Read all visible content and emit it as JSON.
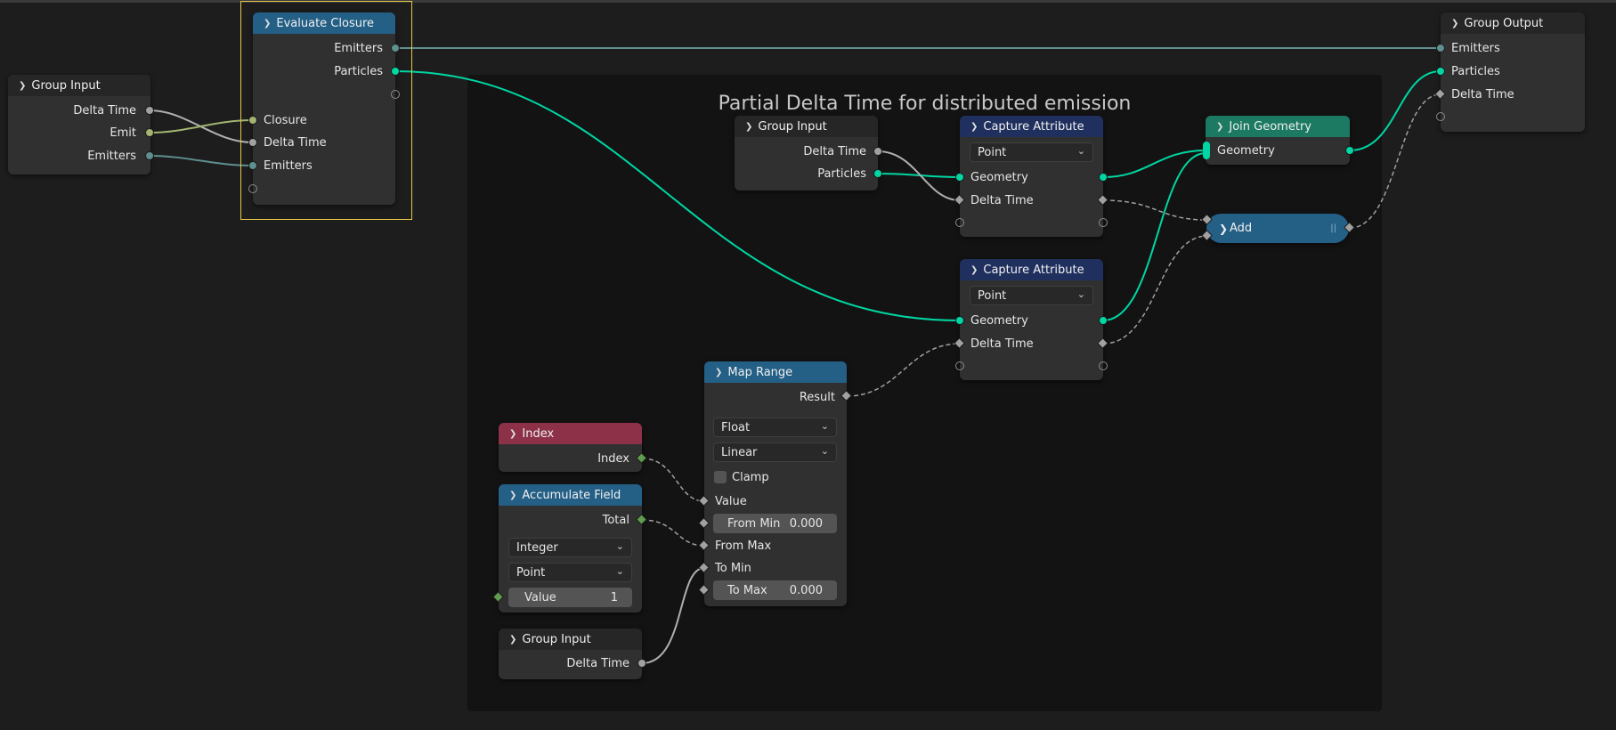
{
  "frame": {
    "label": "Partial Delta Time for distributed emission"
  },
  "nodes": {
    "group_input_left": {
      "title": "Group Input",
      "outputs": [
        "Delta Time",
        "Emit",
        "Emitters"
      ]
    },
    "evaluate_closure": {
      "title": "Evaluate Closure",
      "outputs": [
        "Emitters",
        "Particles"
      ],
      "inputs": [
        "Closure",
        "Delta Time",
        "Emitters"
      ]
    },
    "group_output": {
      "title": "Group Output",
      "inputs": [
        "Emitters",
        "Particles",
        "Delta Time"
      ]
    },
    "group_input_frame": {
      "title": "Group Input",
      "outputs": [
        "Delta Time",
        "Particles"
      ]
    },
    "capture_attribute_1": {
      "title": "Capture Attribute",
      "domain": "Point",
      "rows": [
        "Geometry",
        "Delta Time"
      ]
    },
    "capture_attribute_2": {
      "title": "Capture Attribute",
      "domain": "Point",
      "rows": [
        "Geometry",
        "Delta Time"
      ]
    },
    "join_geometry": {
      "title": "Join Geometry",
      "rows": [
        "Geometry"
      ]
    },
    "add": {
      "title": "Add"
    },
    "map_range": {
      "title": "Map Range",
      "result": "Result",
      "data_type": "Float",
      "interpolation": "Linear",
      "clamp": "Clamp",
      "value": "Value",
      "from_min_label": "From Min",
      "from_min_value": "0.000",
      "from_max": "From Max",
      "to_min": "To Min",
      "to_max_label": "To Max",
      "to_max_value": "0.000"
    },
    "index": {
      "title": "Index",
      "output": "Index"
    },
    "accumulate_field": {
      "title": "Accumulate Field",
      "output": "Total",
      "data_type": "Integer",
      "domain": "Point",
      "value_label": "Value",
      "value": "1"
    },
    "group_input_bottom": {
      "title": "Group Input",
      "output": "Delta Time"
    }
  },
  "colors": {
    "geometry_socket": "#00d6a3",
    "float_socket": "#a1a1a1",
    "int_socket": "#5f9c4f",
    "closure_socket": "#a2b46f",
    "selection": "#e6c74a"
  }
}
